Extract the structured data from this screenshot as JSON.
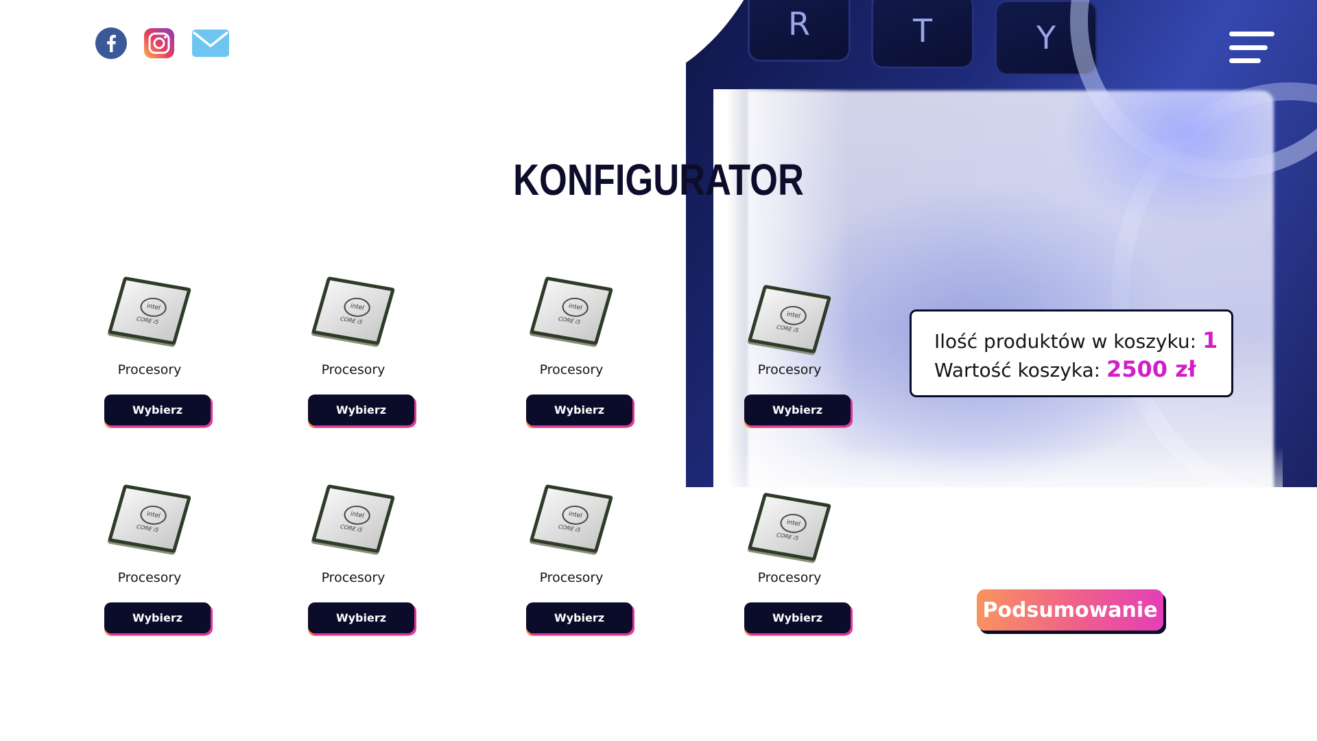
{
  "header": {
    "social_icons": [
      "facebook-icon",
      "instagram-icon",
      "mail-icon"
    ],
    "menu_icon": "hamburger-menu-icon"
  },
  "background": {
    "keys": [
      "R",
      "T",
      "Y"
    ]
  },
  "page": {
    "title": "KONFIGURATOR"
  },
  "products": [
    {
      "label": "Procesory",
      "button": "Wybierz",
      "chip_brand": "intel",
      "chip_model": "CORE i5"
    },
    {
      "label": "Procesory",
      "button": "Wybierz",
      "chip_brand": "intel",
      "chip_model": "CORE i5"
    },
    {
      "label": "Procesory",
      "button": "Wybierz",
      "chip_brand": "intel",
      "chip_model": "CORE i5"
    },
    {
      "label": "Procesory",
      "button": "Wybierz",
      "chip_brand": "intel",
      "chip_model": "CORE i5"
    },
    {
      "label": "Procesory",
      "button": "Wybierz",
      "chip_brand": "intel",
      "chip_model": "CORE i5"
    },
    {
      "label": "Procesory",
      "button": "Wybierz",
      "chip_brand": "intel",
      "chip_model": "CORE i5"
    },
    {
      "label": "Procesory",
      "button": "Wybierz",
      "chip_brand": "intel",
      "chip_model": "CORE i5"
    },
    {
      "label": "Procesory",
      "button": "Wybierz",
      "chip_brand": "intel",
      "chip_model": "CORE i5"
    }
  ],
  "cart": {
    "count_label": "Ilość produktów w koszyku:",
    "count_value": "1",
    "total_label": "Wartość koszyka:",
    "total_value": "2500 zł"
  },
  "summary": {
    "button_label": "Podsumowanie"
  },
  "colors": {
    "navy": "#0b0b2a",
    "accent_pink": "#d11fc8",
    "gradient_start": "#f9935f",
    "gradient_end": "#e33fb7"
  }
}
